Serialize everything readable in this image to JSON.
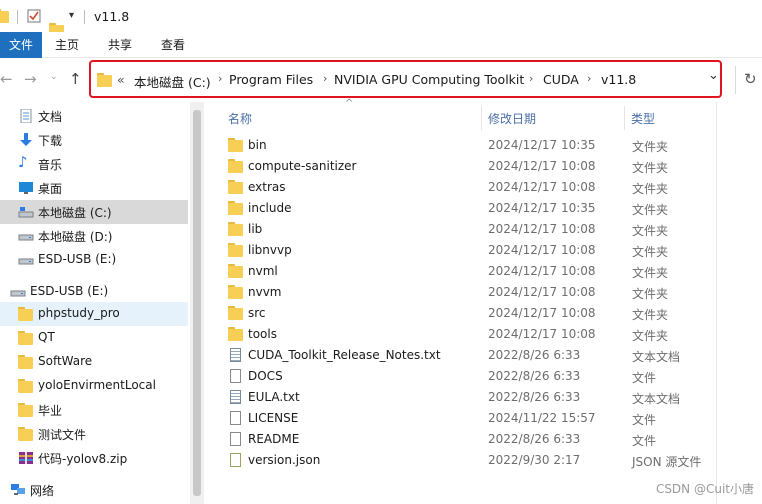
{
  "titlebar": {
    "title": "v11.8"
  },
  "ribbon": {
    "tabs": [
      "文件",
      "主页",
      "共享",
      "查看"
    ]
  },
  "nav": {
    "back": "←",
    "forward": "→",
    "up": "↑",
    "chevron": "«",
    "breadcrumb": [
      "本地磁盘 (C:)",
      "Program Files",
      "NVIDIA GPU Computing Toolkit",
      "CUDA",
      "v11.8"
    ],
    "dropdown": "⌄",
    "refresh": "↻"
  },
  "sidebar": {
    "items": [
      {
        "label": "文档",
        "icon": "document-icon"
      },
      {
        "label": "下载",
        "icon": "download-icon"
      },
      {
        "label": "音乐",
        "icon": "music-icon"
      },
      {
        "label": "桌面",
        "icon": "desktop-icon"
      },
      {
        "label": "本地磁盘 (C:)",
        "icon": "drive-icon"
      },
      {
        "label": "本地磁盘 (D:)",
        "icon": "drive-icon"
      },
      {
        "label": "ESD-USB (E:)",
        "icon": "usb-drive-icon"
      },
      {
        "label": "ESD-USB (E:)",
        "icon": "usb-drive-icon"
      },
      {
        "label": "phpstudy_pro",
        "icon": "folder-icon"
      },
      {
        "label": "QT",
        "icon": "folder-icon"
      },
      {
        "label": "SoftWare",
        "icon": "folder-icon"
      },
      {
        "label": "yoloEnvirmentLocal",
        "icon": "folder-icon"
      },
      {
        "label": "毕业",
        "icon": "folder-icon"
      },
      {
        "label": "测试文件",
        "icon": "folder-icon"
      },
      {
        "label": "代码-yolov8.zip",
        "icon": "zip-archive-icon"
      },
      {
        "label": "网络",
        "icon": "network-icon"
      }
    ]
  },
  "columns": {
    "name": "名称",
    "date": "修改日期",
    "type": "类型"
  },
  "files": [
    {
      "name": "bin",
      "date": "2024/12/17 10:35",
      "type": "文件夹",
      "kind": "folder"
    },
    {
      "name": "compute-sanitizer",
      "date": "2024/12/17 10:08",
      "type": "文件夹",
      "kind": "folder"
    },
    {
      "name": "extras",
      "date": "2024/12/17 10:08",
      "type": "文件夹",
      "kind": "folder"
    },
    {
      "name": "include",
      "date": "2024/12/17 10:35",
      "type": "文件夹",
      "kind": "folder"
    },
    {
      "name": "lib",
      "date": "2024/12/17 10:08",
      "type": "文件夹",
      "kind": "folder"
    },
    {
      "name": "libnvvp",
      "date": "2024/12/17 10:08",
      "type": "文件夹",
      "kind": "folder"
    },
    {
      "name": "nvml",
      "date": "2024/12/17 10:08",
      "type": "文件夹",
      "kind": "folder"
    },
    {
      "name": "nvvm",
      "date": "2024/12/17 10:08",
      "type": "文件夹",
      "kind": "folder"
    },
    {
      "name": "src",
      "date": "2024/12/17 10:08",
      "type": "文件夹",
      "kind": "folder"
    },
    {
      "name": "tools",
      "date": "2024/12/17 10:08",
      "type": "文件夹",
      "kind": "folder"
    },
    {
      "name": "CUDA_Toolkit_Release_Notes.txt",
      "date": "2022/8/26 6:33",
      "type": "文本文档",
      "kind": "text"
    },
    {
      "name": "DOCS",
      "date": "2022/8/26 6:33",
      "type": "文件",
      "kind": "file"
    },
    {
      "name": "EULA.txt",
      "date": "2022/8/26 6:33",
      "type": "文本文档",
      "kind": "text"
    },
    {
      "name": "LICENSE",
      "date": "2024/11/22 15:57",
      "type": "文件",
      "kind": "file"
    },
    {
      "name": "README",
      "date": "2022/8/26 6:33",
      "type": "文件",
      "kind": "file"
    },
    {
      "name": "version.json",
      "date": "2022/9/30 2:17",
      "type": "JSON 源文件",
      "kind": "json"
    }
  ],
  "watermark": "CSDN @Cuit小唐",
  "colors": {
    "accent": "#1f6fbf",
    "highlight": "#e0141e",
    "folder": "#f7cf55"
  }
}
